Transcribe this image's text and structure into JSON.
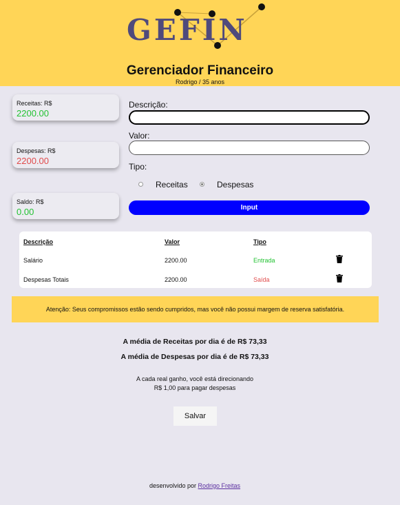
{
  "header": {
    "logo_text": "GEFIN",
    "title": "Gerenciador Financeiro",
    "subtitle": "Rodrigo / 35 anos"
  },
  "summary": {
    "receitas": {
      "label": "Receitas: R$",
      "value": "2200.00",
      "color": "#22c232"
    },
    "despesas": {
      "label": "Despesas: R$",
      "value": "2200.00",
      "color": "#e04b4b"
    },
    "saldo": {
      "label": "Saldo: R$",
      "value": "0.00",
      "color": "#22c232"
    }
  },
  "form": {
    "descricao_label": "Descrição:",
    "descricao_value": "",
    "valor_label": "Valor:",
    "valor_value": "",
    "tipo_label": "Tipo:",
    "options": [
      {
        "label": "Receitas",
        "checked": false
      },
      {
        "label": "Despesas",
        "checked": true
      }
    ],
    "submit_label": "Input"
  },
  "table": {
    "headers": [
      "Descrição",
      "Valor",
      "Tipo"
    ],
    "rows": [
      {
        "descricao": "Salário",
        "valor": "2200.00",
        "tipo": "Entrada",
        "tipo_color": "#22c232"
      },
      {
        "descricao": "Despesas Totais",
        "valor": "2200.00",
        "tipo": "Saída",
        "tipo_color": "#e04b4b"
      }
    ]
  },
  "alert": {
    "text": "Atenção: Seus compromissos estão sendo cumpridos, mas você não possui margem de reserva satisfatória."
  },
  "averages": {
    "receitas": "A média de Receitas por dia é de R$ 73,33",
    "despesas": "A média de Despesas por dia é de R$ 73,33"
  },
  "ratio": {
    "line1": "A cada real ganho, você está direcionando",
    "line2": "R$ 1,00 para pagar despesas"
  },
  "save_label": "Salvar",
  "footer": {
    "prefix": "desenvolvido por",
    "author": "Rodrigo Freitas"
  },
  "colors": {
    "accent_yellow": "#ffd557",
    "primary_blue": "#0000ff",
    "background": "#e8e6ef"
  }
}
